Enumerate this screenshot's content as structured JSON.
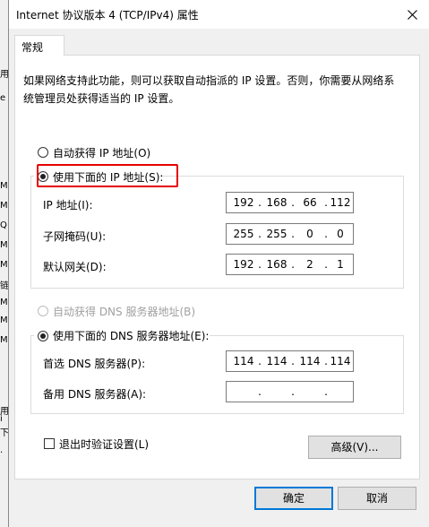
{
  "background_window": {
    "edge_chars": [
      "用",
      "e",
      "M",
      "M",
      "Q",
      "M",
      "M",
      "链",
      "M",
      "M",
      "M",
      "用",
      "i",
      "下",
      "·"
    ]
  },
  "dialog": {
    "title": "Internet 协议版本 4 (TCP/IPv4) 属性",
    "tab_label": "常规",
    "description": "如果网络支持此功能，则可以获取自动指派的 IP 设置。否则，你需要从网络系统管理员处获得适当的 IP 设置。",
    "radio_auto_ip": "自动获得 IP 地址(O)",
    "radio_manual_ip": "使用下面的 IP 地址(S):",
    "ip_label": "IP 地址(I):",
    "ip_address": [
      "192",
      "168",
      "66",
      "112"
    ],
    "subnet_label": "子网掩码(U):",
    "subnet_mask": [
      "255",
      "255",
      "0",
      "0"
    ],
    "gateway_label": "默认网关(D):",
    "gateway": [
      "192",
      "168",
      "2",
      "1"
    ],
    "radio_auto_dns": "自动获得 DNS 服务器地址(B)",
    "radio_manual_dns": "使用下面的 DNS 服务器地址(E):",
    "pref_dns_label": "首选 DNS 服务器(P):",
    "pref_dns": [
      "114",
      "114",
      "114",
      "114"
    ],
    "alt_dns_label": "备用 DNS 服务器(A):",
    "alt_dns": [
      "",
      "",
      "",
      ""
    ],
    "validate_label": "退出时验证设置(L)",
    "validate_checked": false,
    "advanced_button": "高级(V)...",
    "ok_button": "确定",
    "cancel_button": "取消"
  },
  "colors": {
    "highlight_box": "#e60000",
    "primary_button_border": "#0078d7"
  }
}
